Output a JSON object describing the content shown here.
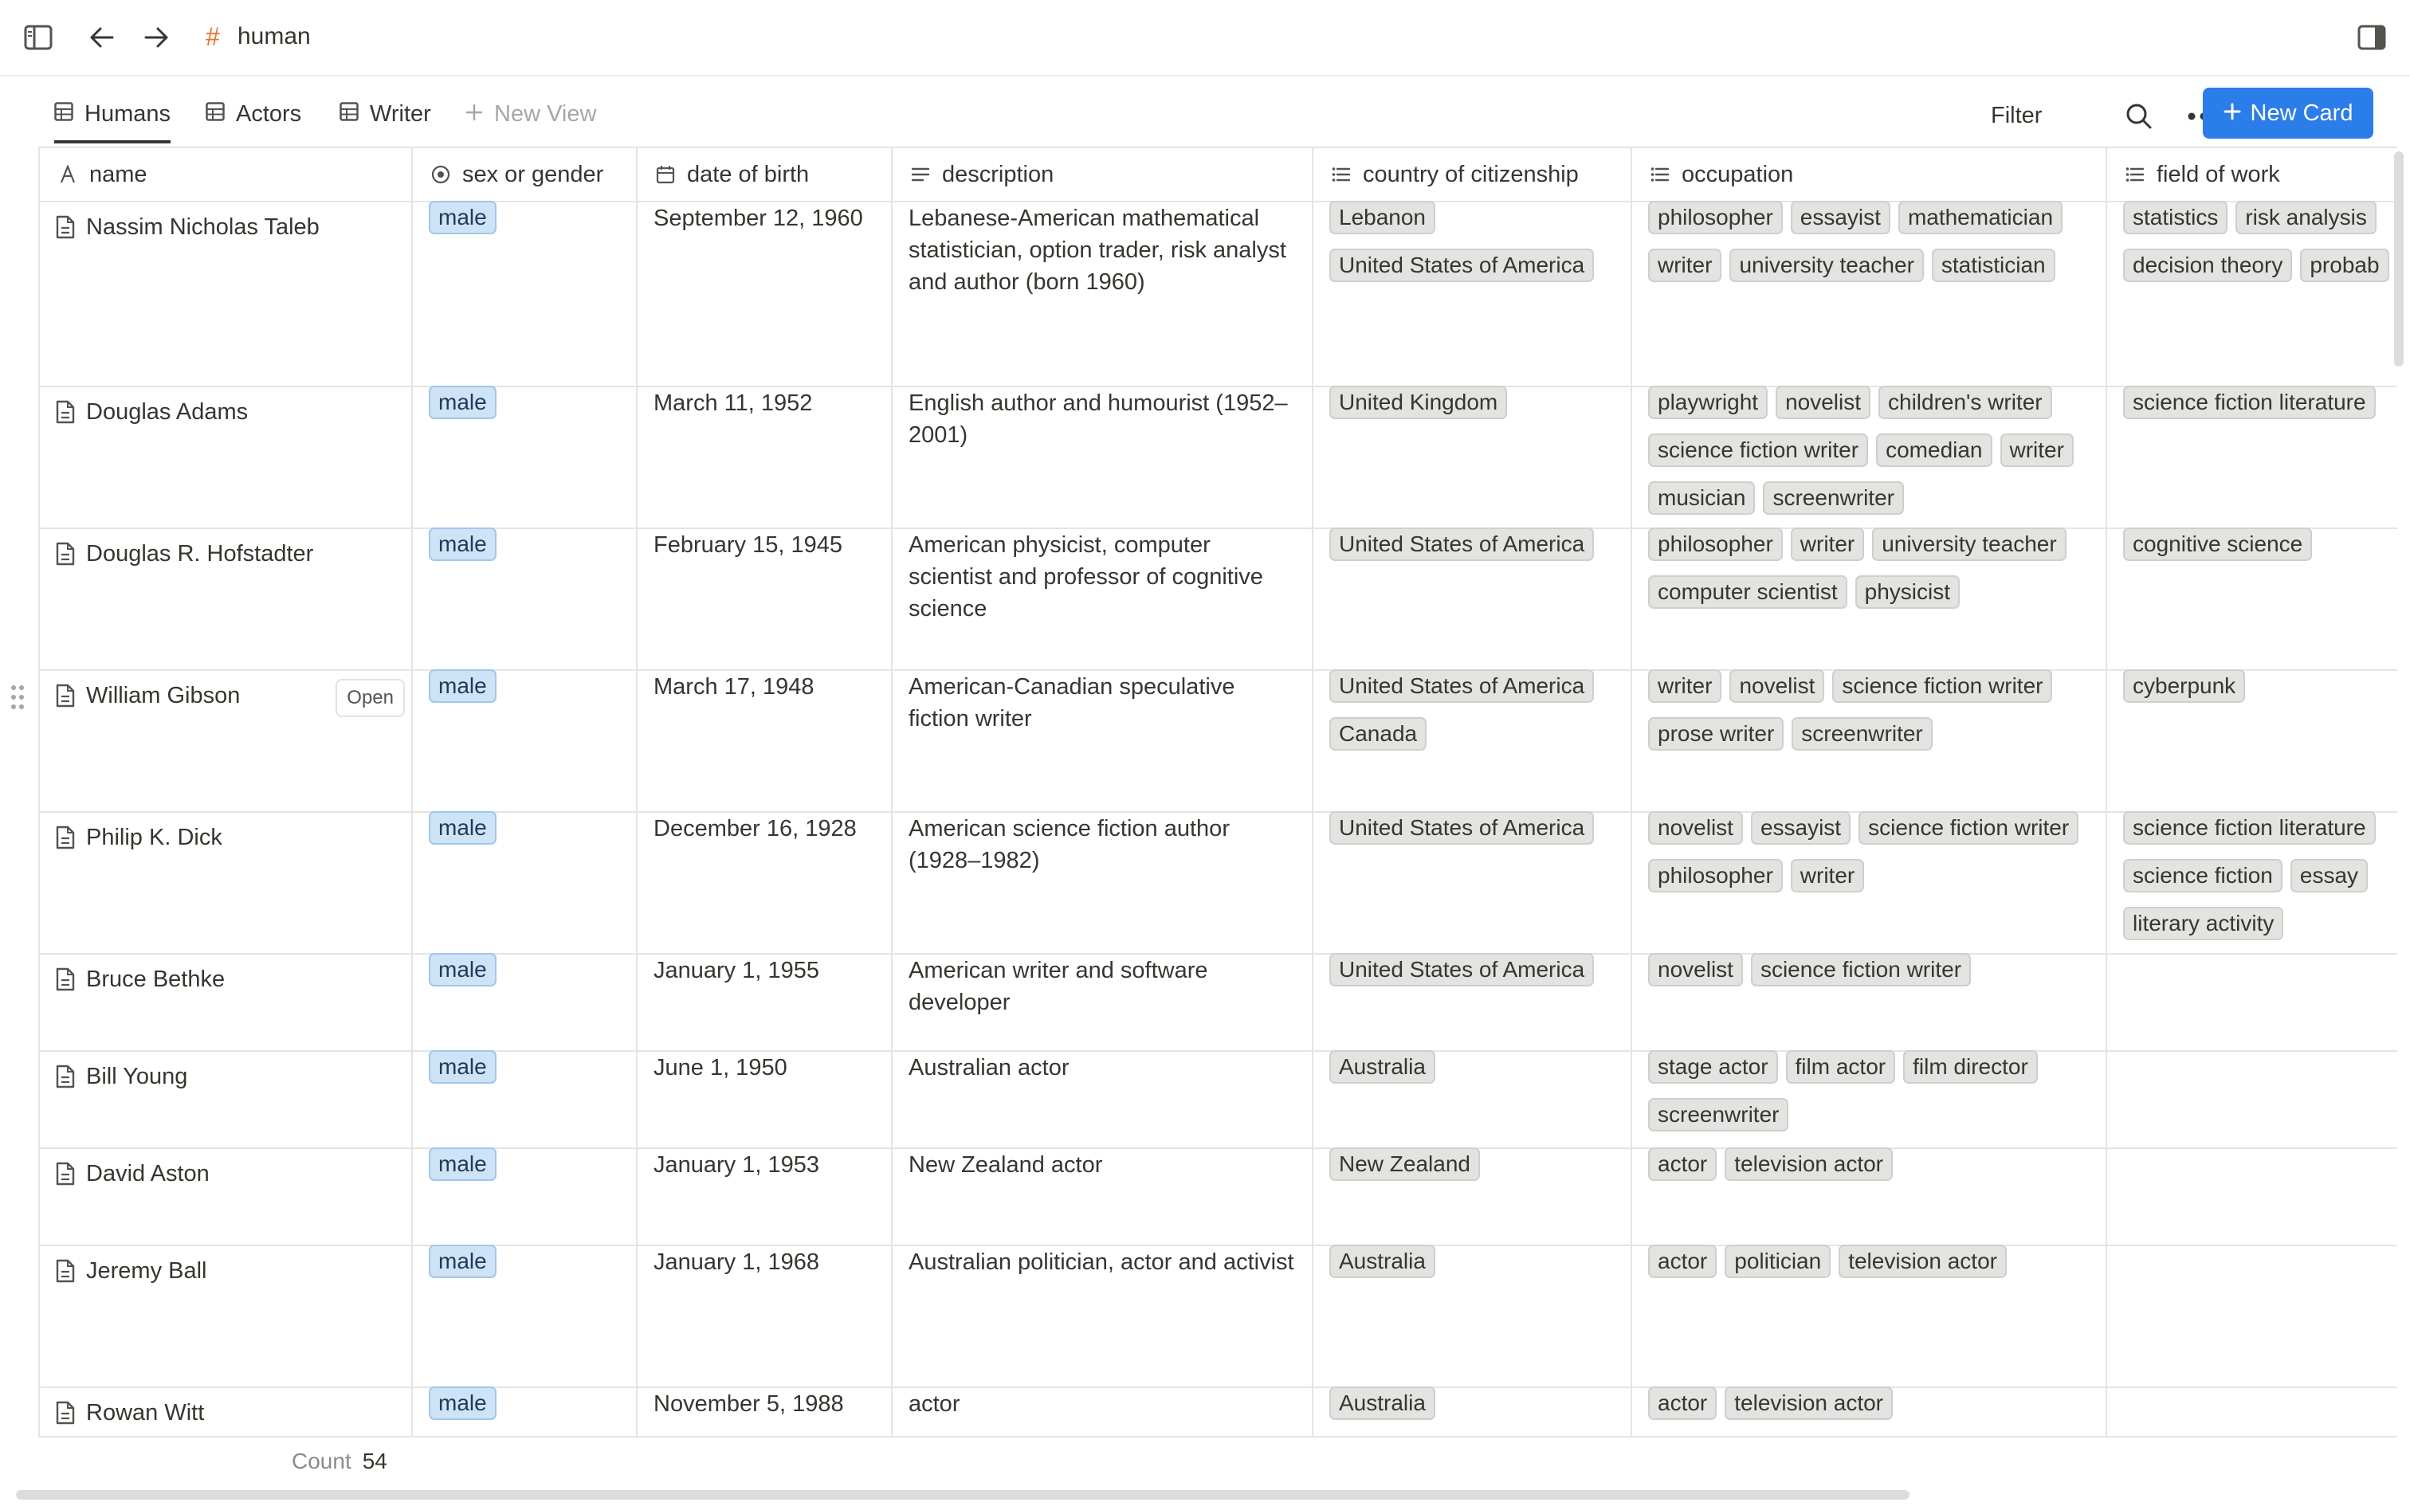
{
  "breadcrumb": {
    "title": "human"
  },
  "views": {
    "tabs": [
      {
        "label": "Humans"
      },
      {
        "label": "Actors"
      },
      {
        "label": "Writer"
      }
    ],
    "new_view_label": "New View",
    "filter_label": "Filter",
    "new_card_label": "New Card"
  },
  "columns": [
    {
      "label": "name"
    },
    {
      "label": "sex or gender"
    },
    {
      "label": "date of birth"
    },
    {
      "label": "description"
    },
    {
      "label": "country of citizenship"
    },
    {
      "label": "occupation"
    },
    {
      "label": "field of work"
    }
  ],
  "open_label": "Open",
  "rows": [
    {
      "name": "Nassim Nicholas Taleb",
      "sex": "male",
      "dob": "September 12, 1960",
      "description": "Lebanese-American mathematical statistician, option trader, risk analyst and author (born 1960)",
      "country": [
        "Lebanon",
        "United States of America"
      ],
      "occupation": [
        "philosopher",
        "essayist",
        "mathematician",
        "writer",
        "university teacher",
        "statistician"
      ],
      "field": [
        "statistics",
        "risk analysis",
        "decision theory",
        "probab"
      ]
    },
    {
      "name": "Douglas Adams",
      "sex": "male",
      "dob": "March 11, 1952",
      "description": "English author and humourist (1952–2001)",
      "country": [
        "United Kingdom"
      ],
      "occupation": [
        "playwright",
        "novelist",
        "children's writer",
        "science fiction writer",
        "comedian",
        "writer",
        "musician",
        "screenwriter"
      ],
      "field": [
        "science fiction literature"
      ]
    },
    {
      "name": "Douglas R. Hofstadter",
      "sex": "male",
      "dob": "February 15, 1945",
      "description": "American physicist, computer scientist and professor of cognitive science",
      "country": [
        "United States of America"
      ],
      "occupation": [
        "philosopher",
        "writer",
        "university teacher",
        "computer scientist",
        "physicist"
      ],
      "field": [
        "cognitive science"
      ]
    },
    {
      "name": "William Gibson",
      "sex": "male",
      "dob": "March 17, 1948",
      "description": "American-Canadian speculative fiction writer",
      "country": [
        "United States of America",
        "Canada"
      ],
      "occupation": [
        "writer",
        "novelist",
        "science fiction writer",
        "prose writer",
        "screenwriter"
      ],
      "field": [
        "cyberpunk"
      ]
    },
    {
      "name": "Philip K. Dick",
      "sex": "male",
      "dob": "December 16, 1928",
      "description": "American science fiction author (1928–1982)",
      "country": [
        "United States of America"
      ],
      "occupation": [
        "novelist",
        "essayist",
        "science fiction writer",
        "philosopher",
        "writer"
      ],
      "field": [
        "science fiction literature",
        "science fiction",
        "essay",
        "literary activity"
      ]
    },
    {
      "name": "Bruce Bethke",
      "sex": "male",
      "dob": "January 1, 1955",
      "description": "American writer and software developer",
      "country": [
        "United States of America"
      ],
      "occupation": [
        "novelist",
        "science fiction writer"
      ],
      "field": []
    },
    {
      "name": "Bill Young",
      "sex": "male",
      "dob": "June 1, 1950",
      "description": "Australian actor",
      "country": [
        "Australia"
      ],
      "occupation": [
        "stage actor",
        "film actor",
        "film director",
        "screenwriter"
      ],
      "field": []
    },
    {
      "name": "David Aston",
      "sex": "male",
      "dob": "January 1, 1953",
      "description": "New Zealand actor",
      "country": [
        "New Zealand"
      ],
      "occupation": [
        "actor",
        "television actor"
      ],
      "field": []
    },
    {
      "name": "Jeremy Ball",
      "sex": "male",
      "dob": "January 1, 1968",
      "description": "Australian politician, actor and activist",
      "country": [
        "Australia"
      ],
      "occupation": [
        "actor",
        "politician",
        "television actor"
      ],
      "field": []
    },
    {
      "name": "Rowan Witt",
      "sex": "male",
      "dob": "November 5, 1988",
      "description": "actor",
      "country": [
        "Australia"
      ],
      "occupation": [
        "actor",
        "television actor"
      ],
      "field": []
    }
  ],
  "footer": {
    "count_label": "Count",
    "count_value": "54"
  },
  "colors": {
    "accent": "#2b7de9",
    "hash": "#e8742c",
    "gender_tag": "#cfe3f6"
  },
  "icons": [
    "sidebar-toggle-icon",
    "arrow-left-icon",
    "arrow-right-icon",
    "hash-icon",
    "panel-right-icon",
    "table-icon",
    "plus-icon",
    "search-icon",
    "more-icon",
    "document-icon",
    "drag-handle-icon"
  ]
}
